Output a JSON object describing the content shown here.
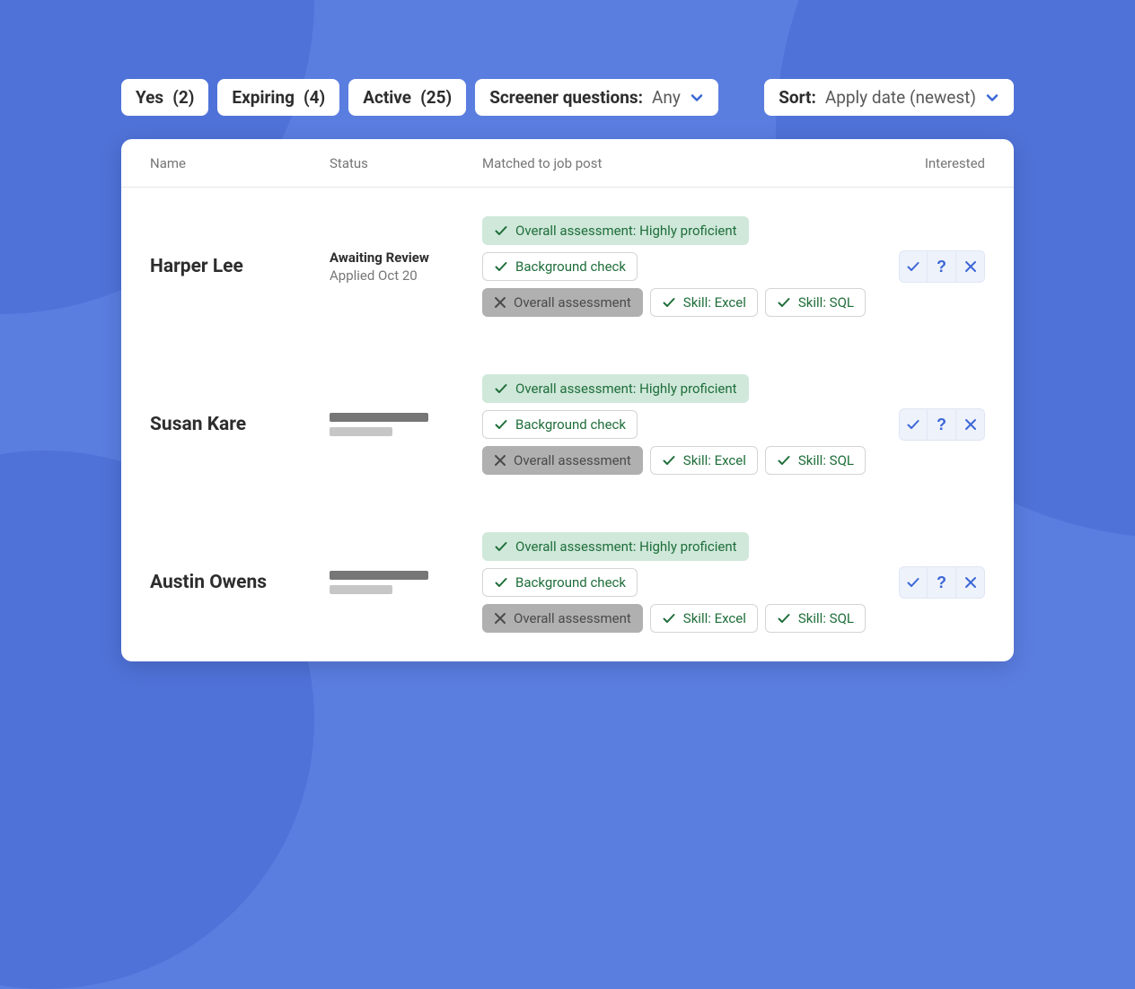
{
  "filters": {
    "yes": {
      "label": "Yes",
      "count": "(2)"
    },
    "expiring": {
      "label": "Expiring",
      "count": "(4)"
    },
    "active": {
      "label": "Active",
      "count": "(25)"
    },
    "screener": {
      "label": "Screener questions:",
      "value": "Any"
    }
  },
  "sort": {
    "label": "Sort:",
    "value": "Apply date (newest)"
  },
  "columns": {
    "name": "Name",
    "status": "Status",
    "matched": "Matched to job post",
    "interested": "Interested"
  },
  "candidates": [
    {
      "name": "Harper Lee",
      "status_title": "Awaiting Review",
      "status_sub": "Applied Oct 20",
      "status_placeholder": false,
      "tags": {
        "overall_proficient": "Overall assessment: Highly proficient",
        "background": "Background check",
        "overall_fail": "Overall assessment",
        "skill_excel": "Skill: Excel",
        "skill_sql": "Skill: SQL"
      }
    },
    {
      "name": "Susan Kare",
      "status_title": "",
      "status_sub": "",
      "status_placeholder": true,
      "tags": {
        "overall_proficient": "Overall assessment: Highly proficient",
        "background": "Background check",
        "overall_fail": "Overall assessment",
        "skill_excel": "Skill: Excel",
        "skill_sql": "Skill: SQL"
      }
    },
    {
      "name": "Austin Owens",
      "status_title": "",
      "status_sub": "",
      "status_placeholder": true,
      "tags": {
        "overall_proficient": "Overall assessment: Highly proficient",
        "background": "Background check",
        "overall_fail": "Overall assessment",
        "skill_excel": "Skill: Excel",
        "skill_sql": "Skill: SQL"
      }
    }
  ]
}
